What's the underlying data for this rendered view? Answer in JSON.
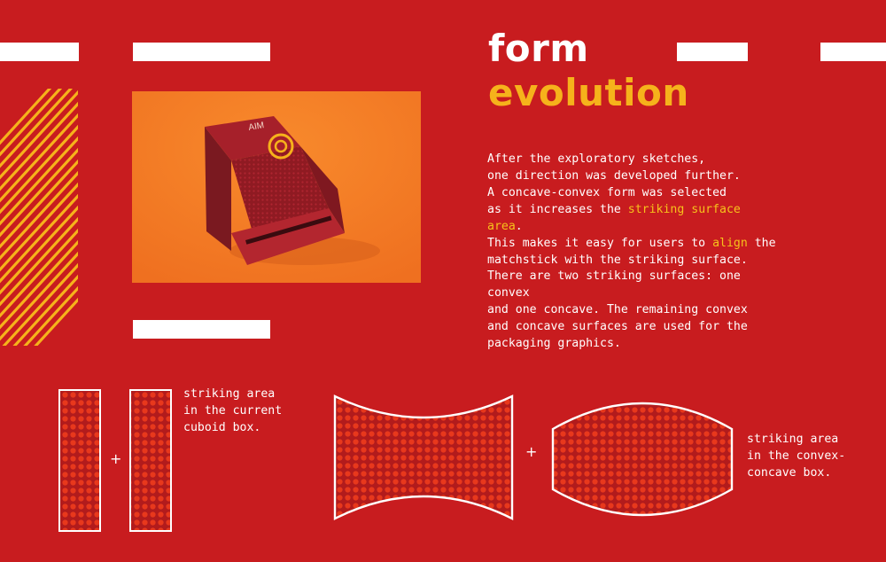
{
  "heading": {
    "line1": "form",
    "line2": "evolution"
  },
  "paragraph1": {
    "lines": [
      "After the exploratory sketches,",
      "one direction was developed further.",
      "A concave-convex form was selected"
    ],
    "line4_pre": "as it increases the ",
    "line4_highlight": "striking surface area",
    "line4_post": ".",
    "line5_pre": "This makes it easy for users to ",
    "line5_highlight": "align",
    "line5_post": " the",
    "line6": "matchstick with the striking surface."
  },
  "paragraph2": {
    "lines": [
      "There are two striking surfaces: one convex",
      "and one concave. The remaining convex",
      "and concave surfaces are used for the",
      "packaging graphics."
    ]
  },
  "photo": {
    "box_brand": "AIM"
  },
  "diagram_left": {
    "plus": "+",
    "caption": [
      "striking area",
      "in the current",
      "cuboid box."
    ]
  },
  "diagram_right": {
    "plus": "+",
    "caption": [
      "striking area",
      "in the convex-",
      "concave box."
    ]
  },
  "colors": {
    "background": "#c81c1f",
    "accent_yellow": "#f6b21b",
    "photo_orange": "#f47c22",
    "dot_orange": "#e8381c"
  }
}
